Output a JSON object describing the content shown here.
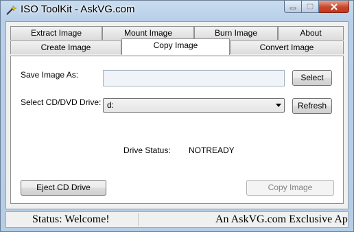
{
  "window": {
    "title": "ISO ToolKit - AskVG.com",
    "icon": "wand-icon",
    "controls": {
      "minimize": "minimize-icon",
      "maximize": "maximize-icon",
      "close": "close-icon"
    }
  },
  "tabs": {
    "row1": [
      "Extract Image",
      "Mount Image",
      "Burn Image",
      "About"
    ],
    "row2": [
      "Create Image",
      "Copy Image",
      "Convert Image"
    ],
    "active": "Copy Image"
  },
  "form": {
    "save_label": "Save Image As:",
    "save_value": "",
    "select_button": "Select",
    "drive_label": "Select CD/DVD Drive:",
    "drive_value": "d:",
    "refresh_button": "Refresh",
    "status_label": "Drive Status:",
    "status_value": "NOTREADY",
    "eject_button": "Eject CD Drive",
    "copy_button": "Copy Image"
  },
  "statusbar": {
    "left": "Status: Welcome!",
    "right": "An AskVG.com Exclusive Ap"
  },
  "colors": {
    "title_gradient_top": "#c9dcef",
    "close_button": "#c8472c",
    "panel_bg": "#ffffff",
    "client_bg": "#f0f0f0"
  }
}
